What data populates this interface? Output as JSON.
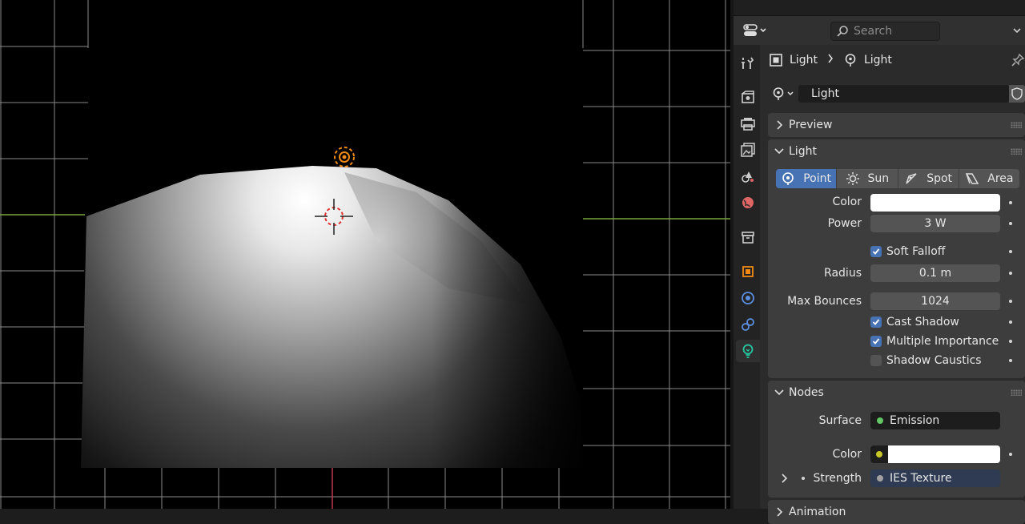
{
  "viewport": {
    "light_color": "#f08a14",
    "cursor_color": "#e03030",
    "grid_color": "#8a8a8a",
    "x_axis_color": "#7aa23a",
    "y_axis_color": "#c0394a"
  },
  "header": {
    "search_placeholder": "Search"
  },
  "breadcrumb": {
    "object": "Light",
    "data": "Light"
  },
  "datablock": {
    "name": "Light"
  },
  "panels": {
    "preview": "Preview",
    "light": "Light",
    "nodes": "Nodes",
    "animation": "Animation"
  },
  "light_types": [
    "Point",
    "Sun",
    "Spot",
    "Area"
  ],
  "light_props": {
    "color_label": "Color",
    "color_value": "#ffffff",
    "power_label": "Power",
    "power_value": "3 W",
    "soft_falloff": "Soft Falloff",
    "radius_label": "Radius",
    "radius_value": "0.1 m",
    "max_bounces_label": "Max Bounces",
    "max_bounces_value": "1024",
    "cast_shadow": "Cast Shadow",
    "multiple_importance": "Multiple Importance",
    "shadow_caustics": "Shadow Caustics"
  },
  "nodes": {
    "surface_label": "Surface",
    "surface_value": "Emission",
    "color_label": "Color",
    "strength_label": "Strength",
    "strength_value": "IES Texture"
  },
  "colors": {
    "accent": "#4772b3",
    "socket_green": "#63c763",
    "socket_yellow": "#c7c729",
    "socket_grey": "#a1a1a1",
    "active_tab_icon": "#23c8a0"
  }
}
